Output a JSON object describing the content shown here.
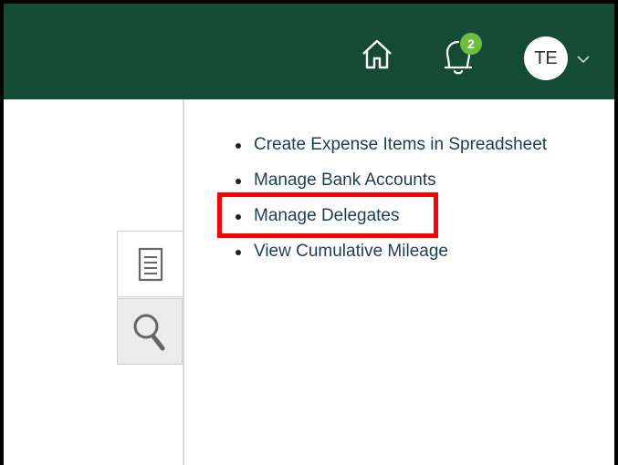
{
  "header": {
    "notifications_count": "2",
    "user_initials": "TE",
    "colors": {
      "bar": "#144a36",
      "badge": "#6bbf3a"
    },
    "icons": [
      "home-icon",
      "bell-icon",
      "chevron-down-icon"
    ]
  },
  "side_tabs": {
    "icons": [
      "tasks-icon",
      "search-icon"
    ]
  },
  "tasks": {
    "items": [
      {
        "label": "Create Expense Items in Spreadsheet"
      },
      {
        "label": "Manage Bank Accounts"
      },
      {
        "label": "Manage Delegates",
        "highlighted": true
      },
      {
        "label": "View Cumulative Mileage"
      }
    ]
  },
  "annotation": {
    "highlight_color": "#ff0000"
  }
}
